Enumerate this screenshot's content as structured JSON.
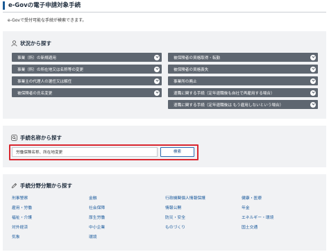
{
  "page": {
    "title": "e-Govの電子申請対象手続",
    "intro": "e-Govで受付可能な手続が検索できます。"
  },
  "situation": {
    "heading": "状況から探す",
    "left": [
      "事業（所）の新規適用",
      "事業（所）の所在地又は名称等の変更",
      "事業主の代理人の選任又は解任",
      "被保険者の氏名変更"
    ],
    "right": [
      "被保険者の資格取得・転勤",
      "被保険者の資格喪失",
      "事業所の廃止",
      "退職に関する手続（定年退職後も自社で再雇用する場合）",
      "退職に関する手続（定年退職後は もう雇用しないという場合）"
    ]
  },
  "name_search": {
    "heading": "手続名称から探す",
    "value": "労働保険名称、所在地変更",
    "button": "検索"
  },
  "category": {
    "heading": "手続分野分類から探す",
    "columns": [
      [
        "刑事警察",
        "雇用・労働",
        "福祉・介護",
        "対外経済",
        "気象"
      ],
      [
        "金融",
        "社会保障",
        "厚生労働",
        "中小企業",
        "環境"
      ],
      [
        "行政機関個人情報保護",
        "情報公開",
        "防災・安全",
        "ものづくり"
      ],
      [
        "健康・医療",
        "年金",
        "エネルギー・環境",
        "国土交通"
      ]
    ]
  },
  "colors": {
    "accent": "#1a5a96",
    "button_bg": "#5e6670",
    "highlight": "#d9262e",
    "link": "#1a5a9c"
  }
}
